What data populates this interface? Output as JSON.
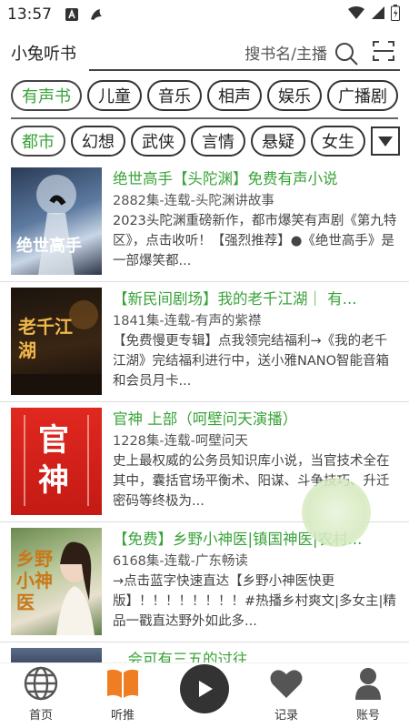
{
  "status": {
    "time": "13:57"
  },
  "header": {
    "brand": "小兔听书",
    "search_placeholder": "搜书名/主播"
  },
  "tags_row1": [
    "有声书",
    "儿童",
    "音乐",
    "相声",
    "娱乐",
    "广播剧"
  ],
  "tags_row2": [
    "都市",
    "幻想",
    "武侠",
    "言情",
    "悬疑",
    "女生"
  ],
  "books": [
    {
      "title": "绝世高手【头陀渊】免费有声小说",
      "meta": "2882集-连载-头陀渊讲故事",
      "desc": "2023头陀渊重磅新作，都市爆笑有声剧《第九特区》，点击收听！【强烈推荐】●《绝世高手》是一部爆笑都...",
      "cover_text": "绝世高手"
    },
    {
      "title": "【新民间剧场】我的老千江湖｜ 有...",
      "meta": "1841集-连载-有声的紫襟",
      "desc": "【免费慢更专辑】点我领完结福利→《我的老千江湖》完结福利进行中，送小雅NANO智能音箱和会员月卡...",
      "cover_text": "老千江湖"
    },
    {
      "title": "官神 上部（呵壁问天演播）",
      "meta": "1228集-连载-呵壁问天",
      "desc": "史上最权威的公务员知识库小说，当官技术全在其中，囊括官场平衡术、阳谋、斗争技巧、升迁密码等终极为...",
      "cover_text": "官神"
    },
    {
      "title": "【免费】乡野小神医|镇国神医|农村...",
      "meta": "6168集-连载-广东畅读",
      "desc": "→点击蓝字快速直达【乡野小神医快更版】！！！！！！！！#热播乡村爽文|多女主|精品一戳直达野外如此多...",
      "cover_text": "乡野小神医"
    },
    {
      "title": "…会可有三五的过往",
      "meta": "",
      "desc": "",
      "cover_text": ""
    }
  ],
  "tabs": [
    "首页",
    "听推",
    "",
    "记录",
    "账号"
  ]
}
